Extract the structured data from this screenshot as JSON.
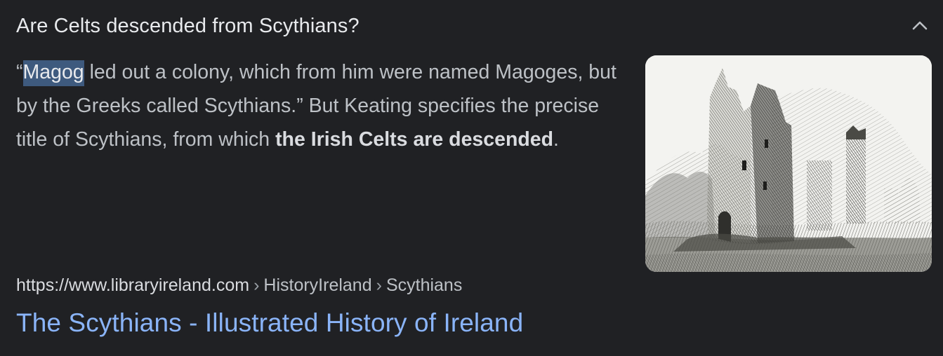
{
  "question": "Are Celts descended from Scythians?",
  "snippet": {
    "open_quote": "“",
    "highlight": "Magog",
    "text_1": " led out a colony, which from him were named Magoges, but by the Greeks called Scythians.” But Keating specifies the precise title of Scythians, from which ",
    "bold_1": "the Irish Celts are descended",
    "text_2": "."
  },
  "source": {
    "domain": "https://www.libraryireland.com",
    "separator": "›",
    "crumbs": [
      "HistoryIreland",
      "Scythians"
    ]
  },
  "result_title": "The Scythians - Illustrated History of Ireland",
  "icons": {
    "collapse": "chevron-up-icon"
  },
  "colors": {
    "background": "#202124",
    "link": "#8ab4f8",
    "highlight": "#3e5a7e"
  }
}
